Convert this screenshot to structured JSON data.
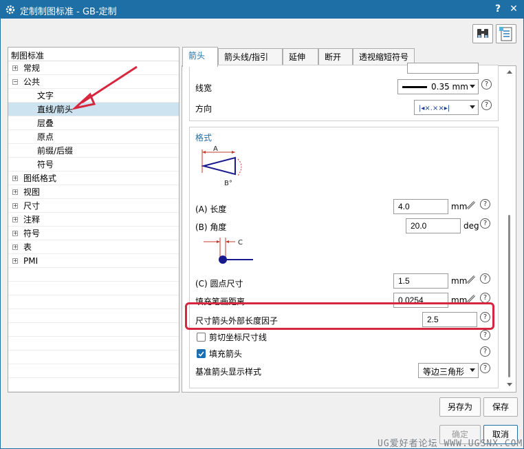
{
  "window": {
    "title": "定制制图标准 - GB-定制",
    "help_label": "?",
    "close_label": "✕"
  },
  "tree": {
    "header": "制图标准",
    "items": [
      {
        "label": "常规",
        "level": 0,
        "expander": "+"
      },
      {
        "label": "公共",
        "level": 0,
        "expander": "−"
      },
      {
        "label": "文字",
        "level": 1
      },
      {
        "label": "直线/箭头",
        "level": 1,
        "selected": true
      },
      {
        "label": "层叠",
        "level": 1
      },
      {
        "label": "原点",
        "level": 1
      },
      {
        "label": "前缀/后缀",
        "level": 1
      },
      {
        "label": "符号",
        "level": 1
      },
      {
        "label": "图纸格式",
        "level": 0,
        "expander": "+"
      },
      {
        "label": "视图",
        "level": 0,
        "expander": "+"
      },
      {
        "label": "尺寸",
        "level": 0,
        "expander": "+"
      },
      {
        "label": "注释",
        "level": 0,
        "expander": "+"
      },
      {
        "label": "符号",
        "level": 0,
        "expander": "+"
      },
      {
        "label": "表",
        "level": 0,
        "expander": "+"
      },
      {
        "label": "PMI",
        "level": 0,
        "expander": "+"
      }
    ]
  },
  "tabs": [
    "箭头",
    "箭头线/指引线",
    "延伸线",
    "断开",
    "透视缩短符号"
  ],
  "line_section": {
    "width_label": "线宽",
    "width_value": "0.35 mm",
    "direction_label": "方向",
    "direction_value": "|◂×.××▸|"
  },
  "format_section": {
    "title": "格式",
    "diagram1_labels": {
      "a": "A",
      "b": "B°"
    },
    "length_label": "(A) 长度",
    "length_value": "4.0",
    "length_unit": "mm",
    "angle_label": "(B) 角度",
    "angle_value": "20.0",
    "angle_unit": "deg",
    "diagram2_label": "C",
    "dot_label": "(C) 圆点尺寸",
    "dot_value": "1.5",
    "dot_unit": "mm",
    "fill_spacing_label": "填充笔画距离",
    "fill_spacing_value": "0.0254",
    "fill_spacing_unit": "mm",
    "outside_factor_label": "尺寸箭头外部长度因子",
    "outside_factor_value": "2.5",
    "clip_label": "剪切坐标尺寸线",
    "clip_checked": false,
    "fill_arrow_label": "填充箭头",
    "fill_arrow_checked": true,
    "datum_label": "基准箭头显示样式",
    "datum_value": "等边三角形"
  },
  "help_glyph": "?",
  "buttons": {
    "save_as": "另存为",
    "save": "保存",
    "ok": "确定",
    "cancel": "取消"
  },
  "watermark": "UG爱好者论坛 WWW.UGSNX.COM",
  "colors": {
    "title_bar": "#1d6fa5",
    "accent": "#1d6fa5",
    "highlight": "#d7263d",
    "selected_row": "#cde4f0"
  }
}
